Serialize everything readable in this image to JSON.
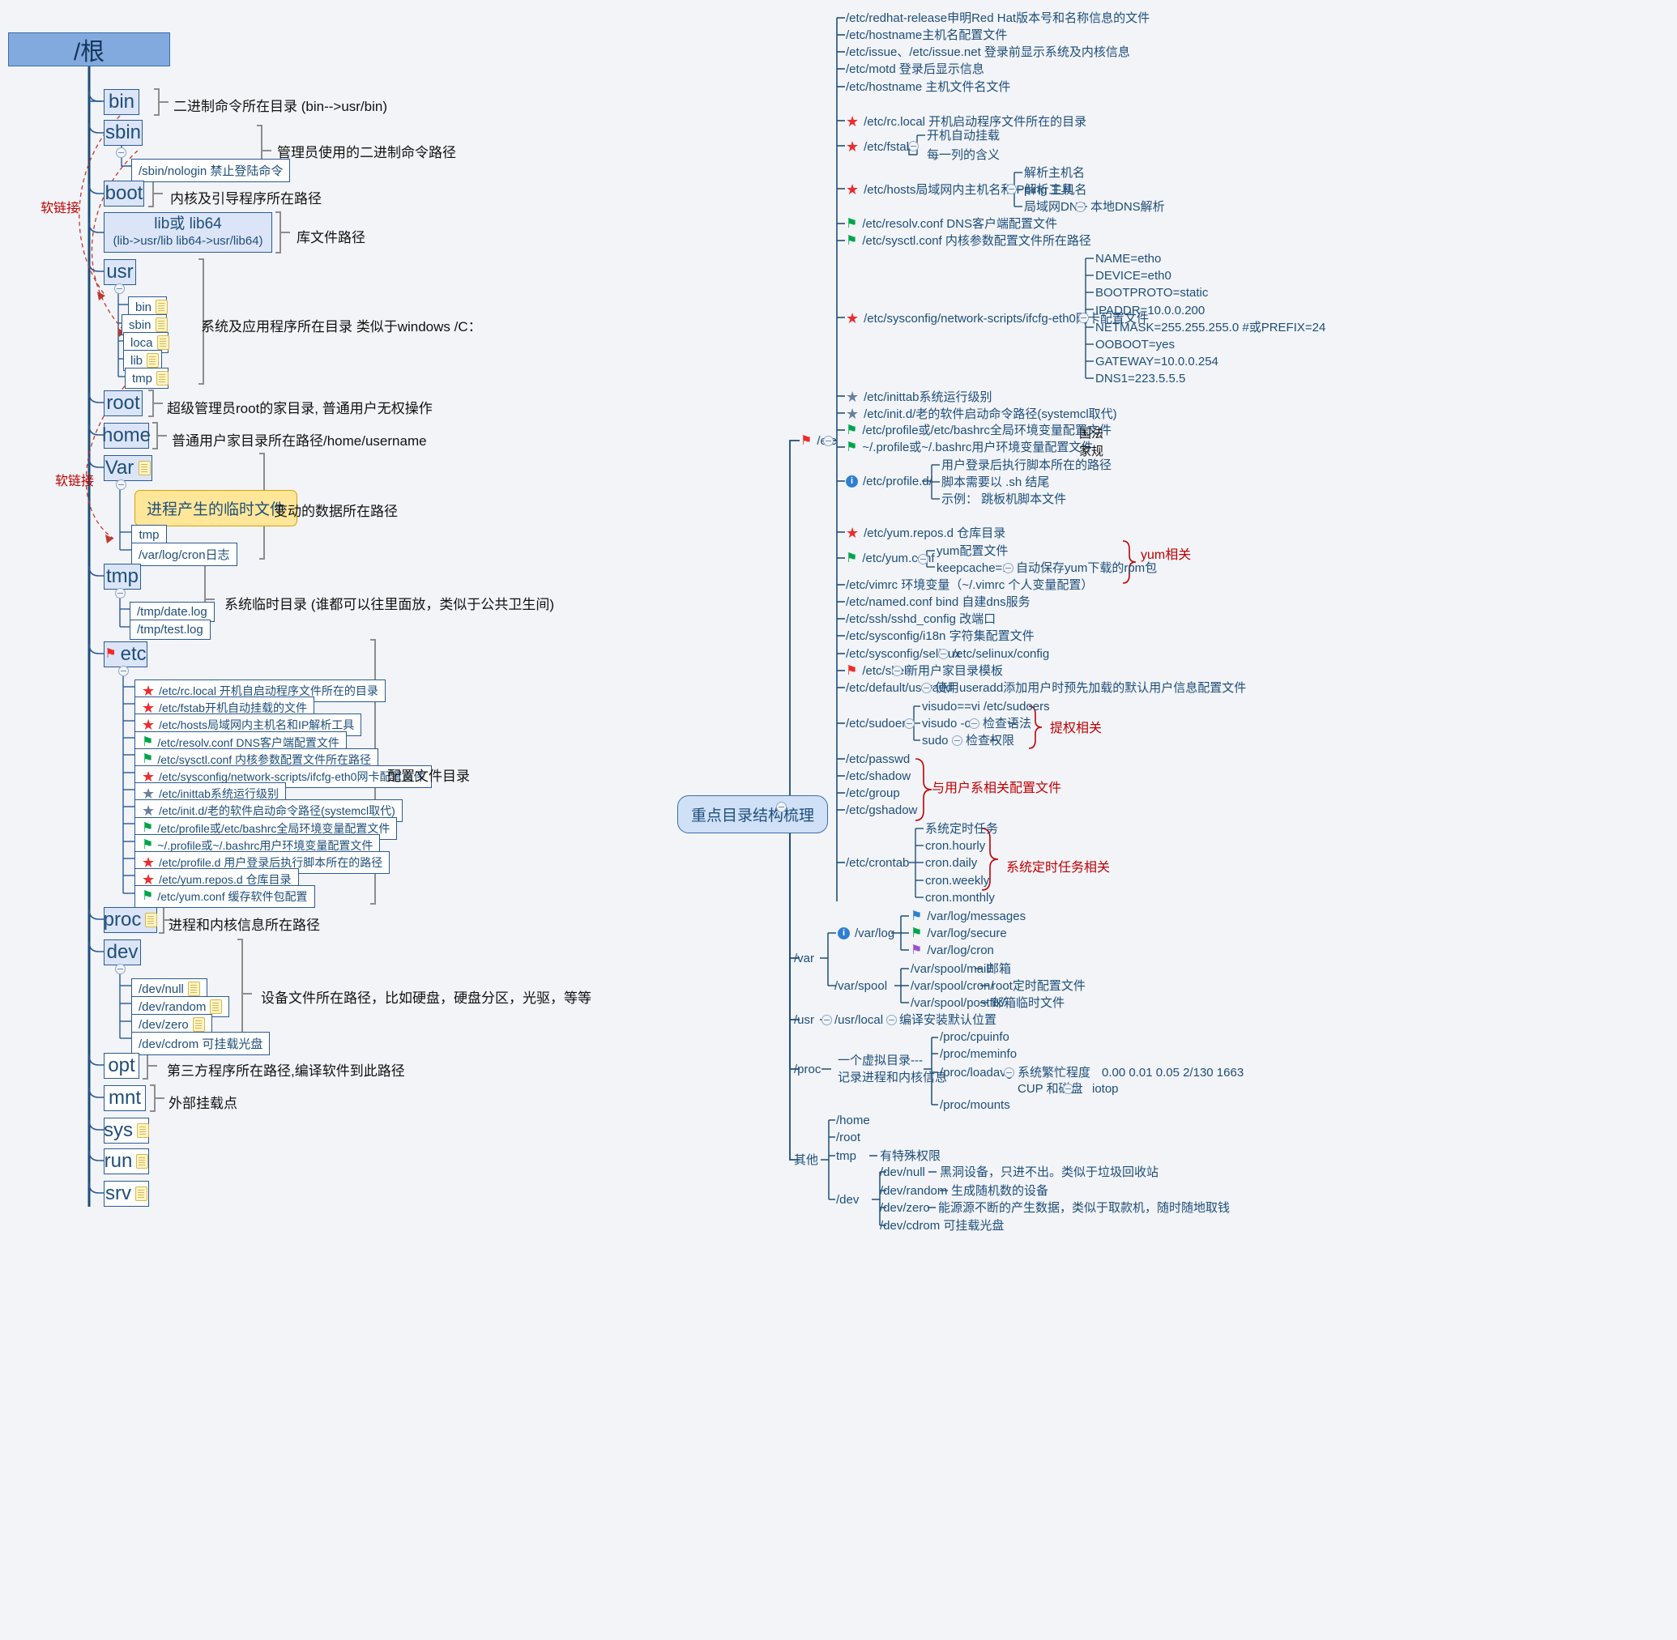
{
  "title_root": "/根",
  "soft_link_label": "软链接",
  "left_tree": {
    "nodes": [
      {
        "key": "bin",
        "label": "bin",
        "note": "二进制命令所在目录 (bin-->usr/bin)"
      },
      {
        "key": "sbin",
        "label": "sbin",
        "note": "管理员使用的二进制命令路径",
        "child": "/sbin/nologin  禁止登陆命令"
      },
      {
        "key": "boot",
        "label": "boot",
        "note": "内核及引导程序所在路径"
      },
      {
        "key": "lib",
        "label": "lib或   lib64\n(lib->usr/lib  lib64->usr/lib64)",
        "note": "库文件路径"
      },
      {
        "key": "usr",
        "label": "usr",
        "note": "系统及应用程序所在目录  类似于windows  /C："
      },
      {
        "key": "root",
        "label": "root",
        "note": "超级管理员root的家目录, 普通用户无权操作"
      },
      {
        "key": "home",
        "label": "home",
        "note": "普通用户家目录所在路径/home/username"
      },
      {
        "key": "var",
        "label": "Var",
        "note": "变动的数据所在路径"
      },
      {
        "key": "tmp",
        "label": "tmp",
        "note": "系统临时目录   (谁都可以往里面放，类似于公共卫生间)"
      },
      {
        "key": "etc",
        "label": "etc",
        "note": "配置文件目录"
      },
      {
        "key": "proc",
        "label": "proc",
        "note": "进程和内核信息所在路径"
      },
      {
        "key": "dev",
        "label": "dev",
        "note": "设备文件所在路径，比如硬盘，硬盘分区，光驱，等等"
      },
      {
        "key": "opt",
        "label": "opt",
        "note": "第三方程序所在路径,编译软件到此路径"
      },
      {
        "key": "mnt",
        "label": "mnt",
        "note": "外部挂载点"
      },
      {
        "key": "sys",
        "label": "sys",
        "note": ""
      },
      {
        "key": "run",
        "label": "run",
        "note": ""
      },
      {
        "key": "srv",
        "label": "srv",
        "note": ""
      }
    ],
    "lib_line1": "lib或   lib64",
    "lib_line2": "(lib->usr/lib  lib64->usr/lib64)",
    "sbin_child": "/sbin/nologin  禁止登陆命令",
    "usr_children": [
      "bin",
      "sbin",
      "loca",
      "lib",
      "tmp"
    ],
    "var_tip": "进程产生的临时文件",
    "var_children": [
      "tmp",
      "/var/log/cron日志"
    ],
    "tmp_children": [
      "/tmp/date.log",
      "/tmp/test.log"
    ],
    "dev_children": [
      "/dev/null",
      "/dev/random",
      "/dev/zero",
      "/dev/cdrom  可挂载光盘"
    ],
    "etc_children": [
      {
        "icon": "star-red",
        "text": "/etc/rc.local  开机自启动程序文件所在的目录"
      },
      {
        "icon": "star-red",
        "text": "/etc/fstab开机自动挂载的文件"
      },
      {
        "icon": "star-red",
        "text": "/etc/hosts局域网内主机名和IP解析工具"
      },
      {
        "icon": "flag-green",
        "text": "/etc/resolv.conf DNS客户端配置文件"
      },
      {
        "icon": "flag-green",
        "text": "/etc/sysctl.conf    内核参数配置文件所在路径"
      },
      {
        "icon": "star-red",
        "text": "/etc/sysconfig/network-scripts/ifcfg-eth0网卡配置文件"
      },
      {
        "icon": "star-gray",
        "text": "/etc/inittab系统运行级别"
      },
      {
        "icon": "star-gray",
        "text": "/etc/init.d/老的软件启动命令路径(systemcl取代)"
      },
      {
        "icon": "flag-green",
        "text": "/etc/profile或/etc/bashrc全局环境变量配置文件"
      },
      {
        "icon": "flag-green",
        "text": "~/.profile或~/.bashrc用户环境变量配置文件"
      },
      {
        "icon": "star-red",
        "text": "/etc/profile.d 用户登录后执行脚本所在的路径"
      },
      {
        "icon": "star-red",
        "text": "/etc/yum.repos.d  仓库目录"
      },
      {
        "icon": "flag-green",
        "text": "/etc/yum.conf   缓存软件包配置"
      }
    ]
  },
  "right_tree": {
    "center_label": "重点目录结构梳理",
    "etc_label": "/etc",
    "var_label": "/var",
    "usr_label": "/usr",
    "proc_label": "/proc",
    "other_label": "其他",
    "etc_items": [
      {
        "icon": "none",
        "text": "/etc/redhat-release申明Red Hat版本号和名称信息的文件"
      },
      {
        "icon": "none",
        "text": "/etc/hostname主机名配置文件"
      },
      {
        "icon": "none",
        "text": "/etc/issue、/etc/issue.net 登录前显示系统及内核信息"
      },
      {
        "icon": "none",
        "text": "/etc/motd 登录后显示信息"
      },
      {
        "icon": "none",
        "text": "/etc/hostname 主机文件名文件"
      },
      {
        "icon": "star-red",
        "text": "/etc/rc.local  开机启动程序文件所在的目录"
      },
      {
        "icon": "star-red",
        "text": "/etc/fstab"
      },
      {
        "icon": "star-red",
        "text": "/etc/hosts局域网内主机名和IP解析工具"
      },
      {
        "icon": "flag-green",
        "text": "/etc/resolv.conf DNS客户端配置文件"
      },
      {
        "icon": "flag-green",
        "text": "/etc/sysctl.conf   内核参数配置文件所在路径"
      },
      {
        "icon": "star-red",
        "text": "/etc/sysconfig/network-scripts/ifcfg-eth0网卡配置文件"
      },
      {
        "icon": "star-gray",
        "text": "/etc/inittab系统运行级别"
      },
      {
        "icon": "star-gray",
        "text": "/etc/init.d/老的软件启动命令路径(systemcl取代)"
      },
      {
        "icon": "flag-green",
        "text": "/etc/profile或/etc/bashrc全局环境变量配置文件"
      },
      {
        "icon": "flag-green",
        "text": "~/.profile或~/.bashrc用户环境变量配置文件"
      },
      {
        "icon": "info",
        "text": "/etc/profile.d/"
      },
      {
        "icon": "star-red",
        "text": "/etc/yum.repos.d  仓库目录"
      },
      {
        "icon": "flag-green",
        "text": "/etc/yum.conf"
      },
      {
        "icon": "none",
        "text": "/etc/vimrc 环境变量（~/.vimrc 个人变量配置）"
      },
      {
        "icon": "none",
        "text": "/etc/named.conf  bind 自建dns服务"
      },
      {
        "icon": "none",
        "text": "/etc/ssh/sshd_config 改端口"
      },
      {
        "icon": "none",
        "text": "/etc/sysconfig/i18n   字符集配置文件"
      },
      {
        "icon": "none",
        "text": "/etc/sysconfig/selinux"
      },
      {
        "icon": "flag-red",
        "text": "/etc/skel"
      },
      {
        "icon": "none",
        "text": "/etc/default/useradd"
      },
      {
        "icon": "none",
        "text": "/etc/sudoers"
      },
      {
        "icon": "none",
        "text": "/etc/passwd"
      },
      {
        "icon": "none",
        "text": "/etc/shadow"
      },
      {
        "icon": "none",
        "text": "/etc/group"
      },
      {
        "icon": "none",
        "text": "/etc/gshadow"
      },
      {
        "icon": "none",
        "text": "/etc/crontab"
      }
    ],
    "fstab_children": [
      "开机自动挂载",
      "每一列的含义"
    ],
    "hosts_children": [
      "解析主机名",
      "ping 主机名",
      "局域网DNS"
    ],
    "hosts_dns_child": "本地DNS解析",
    "ifcfg_children": [
      "NAME=etho",
      "DEVICE=eth0",
      "BOOTPROTO=static",
      "IPADDR=10.0.0.200",
      "NETMASK=255.255.255.0   #或PREFIX=24",
      "OOBOOT=yes",
      "GATEWAY=10.0.0.254",
      "DNS1=223.5.5.5"
    ],
    "profile_note": "国法",
    "bashrc_note": "家规",
    "profiled_children": [
      "用户登录后执行脚本所在的路径",
      "脚本需要以 .sh 结尾",
      "示例：  跳板机脚本文件"
    ],
    "yum_repos_note": "仓库目录",
    "yum_conf_children": [
      "yum配置文件",
      "keepcache=1"
    ],
    "yum_conf_note": "自动保存yum下载的rpm包",
    "yum_brace_label": "yum相关",
    "selinux_child": "/etc/selinux/config",
    "skel_child": "新用户家目录模板",
    "useradd_child": "使用useradd添加用户时预先加载的默认用户信息配置文件",
    "sudoers_children": [
      "visudo==vi /etc/sudoers",
      "visudo -c",
      "sudo -i"
    ],
    "sudoers_notes": [
      "检查语法",
      "检查权限"
    ],
    "sudo_brace_label": "提权相关",
    "user_brace_label": "与用户系相关配置文件",
    "crontab_children": [
      "系统定时任务",
      "cron.hourly",
      "cron.daily",
      "cron.weekly",
      "cron.monthly"
    ],
    "cron_brace_label": "系统定时任务相关",
    "var_children": [
      {
        "icon": "flag-blue",
        "text": "/var/log/messages"
      },
      {
        "icon": "flag-green",
        "text": "/var/log/secure"
      },
      {
        "icon": "flag-purple",
        "text": "/var/log/cron"
      }
    ],
    "var_log_label": "/var/log",
    "var_spool_label": "/var/spool",
    "var_spool_children": [
      {
        "text": "/var/spool/mail/",
        "note": "邮箱"
      },
      {
        "text": "/var/spool/cron/",
        "note": "root定时配置文件"
      },
      {
        "text": "/var/spool/postfix/",
        "note": "邮箱临时文件"
      }
    ],
    "usr_local_label": "/usr/local",
    "usr_local_note": "编译安装默认位置",
    "proc_note_1": "一个虚拟目录---",
    "proc_note_2": "记录进程和内核信息",
    "proc_children": [
      "/proc/cpuinfo",
      "/proc/meminfo",
      "/proc/loadavg",
      "/proc/mounts"
    ],
    "proc_loadavg_note": "系统繁忙程度",
    "proc_loadavg_values": "0.00 0.01 0.05 2/130 1663",
    "proc_cpu_note": "CUP 和磁盘",
    "proc_iotop": "iotop",
    "other_children": [
      "/home",
      "/root",
      "tmp",
      "/dev"
    ],
    "other_tmp_note": "有特殊权限",
    "other_dev_children": [
      {
        "text": "/dev/null",
        "note": "黑洞设备，只进不出。类似于垃圾回收站"
      },
      {
        "text": "/dev/random",
        "note": "生成随机数的设备"
      },
      {
        "text": "/dev/zero",
        "note": "能源源不断的产生数据，类似于取款机，随时随地取钱"
      },
      {
        "text": "/dev/cdrom  可挂载光盘",
        "note": ""
      }
    ]
  }
}
